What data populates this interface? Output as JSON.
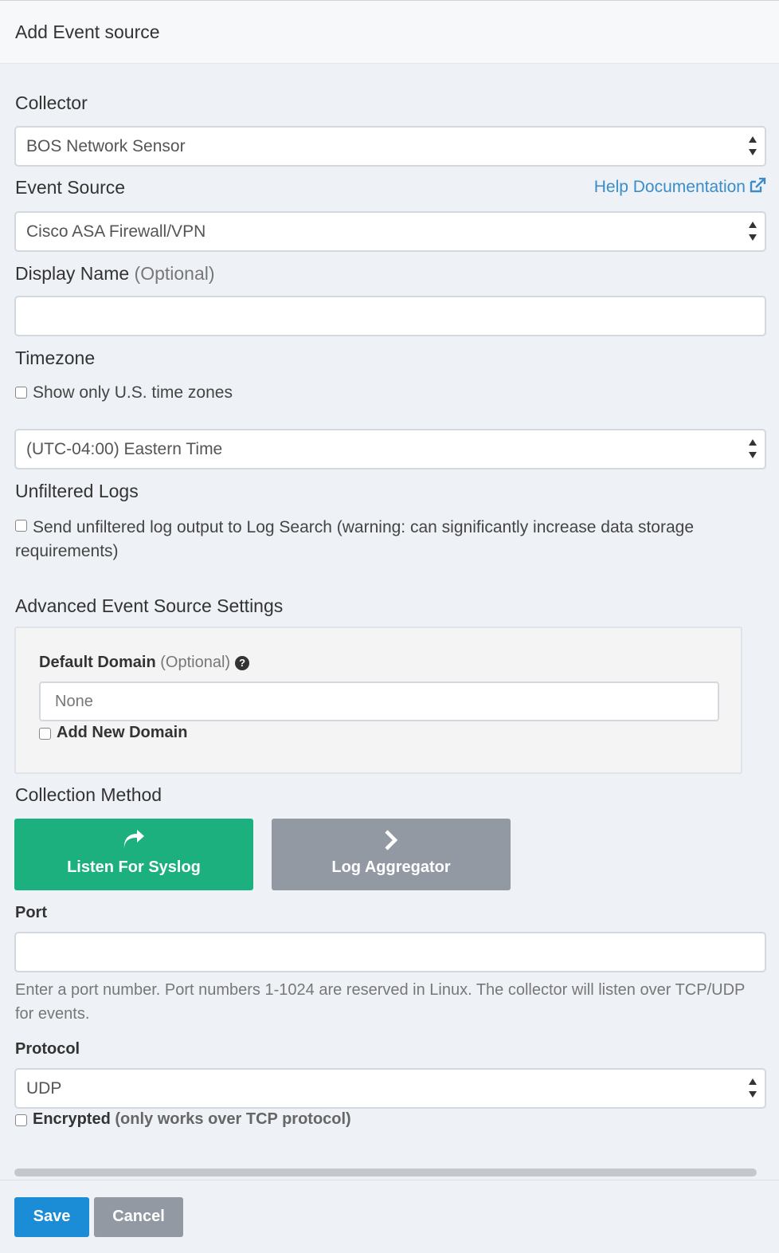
{
  "header": {
    "title": "Add Event source"
  },
  "collector": {
    "label": "Collector",
    "value": "BOS Network Sensor"
  },
  "event_source": {
    "label": "Event Source",
    "help_link": "Help Documentation",
    "value": "Cisco ASA Firewall/VPN"
  },
  "display_name": {
    "label": "Display Name",
    "optional": "(Optional)",
    "value": ""
  },
  "timezone": {
    "label": "Timezone",
    "us_only_label": "Show only U.S. time zones",
    "value": "(UTC-04:00) Eastern Time"
  },
  "unfiltered_logs": {
    "label": "Unfiltered Logs",
    "checkbox_label": "Send unfiltered log output to Log Search (warning: can significantly increase data storage requirements)"
  },
  "advanced": {
    "title": "Advanced Event Source Settings",
    "default_domain_label": "Default Domain",
    "optional": "(Optional)",
    "domain_placeholder": "None",
    "add_domain_label": "Add New Domain"
  },
  "collection_method": {
    "label": "Collection Method",
    "options": [
      {
        "label": "Listen For Syslog",
        "icon": "share-arrow-icon",
        "selected": true
      },
      {
        "label": "Log Aggregator",
        "icon": "chevron-right-icon",
        "selected": false
      }
    ]
  },
  "port": {
    "label": "Port",
    "value": "",
    "help": "Enter a port number. Port numbers 1-1024 are reserved in Linux. The collector will listen over TCP/UDP for events."
  },
  "protocol": {
    "label": "Protocol",
    "value": "UDP",
    "encrypted_label": "Encrypted",
    "encrypted_note": "(only works over TCP protocol)"
  },
  "footer": {
    "save": "Save",
    "cancel": "Cancel"
  },
  "colors": {
    "primary": "#1b8cd6",
    "selected_method": "#1bb07e",
    "muted_button": "#9299a3",
    "link": "#3a8dc8"
  }
}
